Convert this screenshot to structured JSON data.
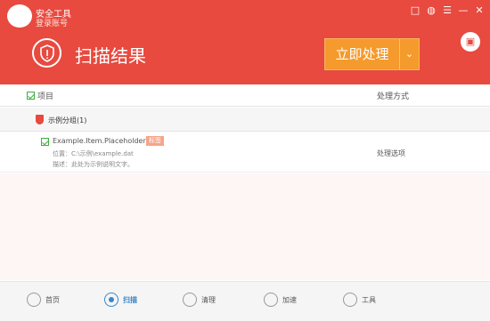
{
  "window": {
    "app_name": "安全工具",
    "login_hint": "登录账号",
    "titlebar_buttons": [
      "□",
      "◍",
      "☰",
      "—",
      "✕"
    ]
  },
  "header": {
    "headline": "扫描结果",
    "action_label": "立即处理",
    "action_arrow": "⌄",
    "side_icon": "▣"
  },
  "table": {
    "col_item": "项目",
    "col_action": "处理方式",
    "group_label": "示例分组(1)",
    "row": {
      "name": "Example.Item.Placeholder",
      "tag": "标签",
      "path": "位置：C:\\示例\\example.dat",
      "desc": "描述：此处为示例说明文字。",
      "action": "处理选项"
    }
  },
  "bottom_nav": [
    {
      "label": "首页",
      "icon": "home-icon"
    },
    {
      "label": "扫描",
      "icon": "scan-icon"
    },
    {
      "label": "清理",
      "icon": "clean-icon"
    },
    {
      "label": "加速",
      "icon": "speed-icon"
    },
    {
      "label": "工具",
      "icon": "tools-icon"
    }
  ],
  "colors": {
    "brand": "#e84a3f",
    "accent": "#f59a2c",
    "nav_active": "#3a86c8"
  }
}
